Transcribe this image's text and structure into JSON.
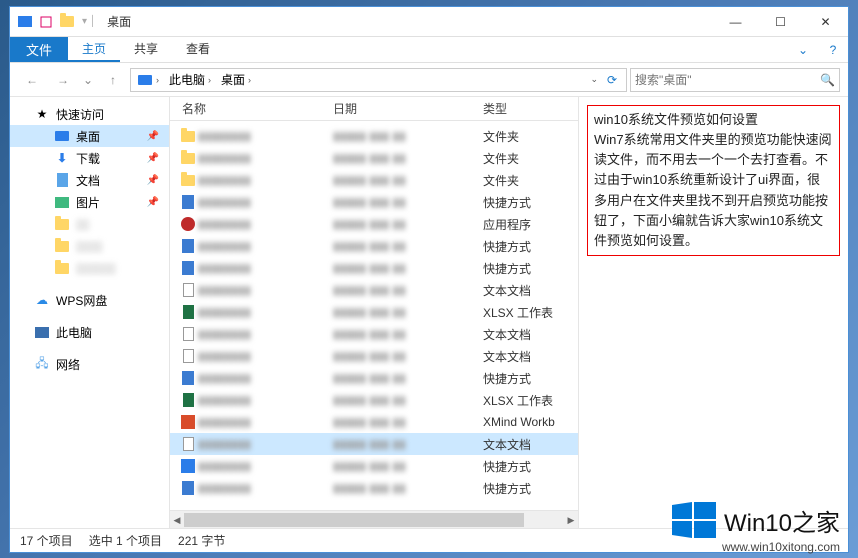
{
  "titlebar": {
    "title": "桌面"
  },
  "ribbon": {
    "file": "文件",
    "tabs": [
      "主页",
      "共享",
      "查看"
    ]
  },
  "address": {
    "segments": [
      "此电脑",
      "桌面"
    ]
  },
  "search": {
    "placeholder": "搜索\"桌面\""
  },
  "sidebar": {
    "quick": "快速访问",
    "items": [
      {
        "label": "桌面",
        "icon": "desktop",
        "pinned": true,
        "selected": true
      },
      {
        "label": "下载",
        "icon": "down",
        "pinned": true
      },
      {
        "label": "文档",
        "icon": "doc",
        "pinned": true
      },
      {
        "label": "图片",
        "icon": "pic",
        "pinned": true
      }
    ],
    "recent": [
      {
        "label": "▯▯",
        "icon": "folder"
      },
      {
        "label": "▯▯▯▯",
        "icon": "folder"
      },
      {
        "label": "▯▯▯▯▯▯",
        "icon": "folder"
      }
    ],
    "wps": "WPS网盘",
    "pc": "此电脑",
    "net": "网络"
  },
  "columns": {
    "name": "名称",
    "date": "日期",
    "type": "类型"
  },
  "rows": [
    {
      "icon": "folder",
      "type": "文件夹"
    },
    {
      "icon": "folder",
      "type": "文件夹"
    },
    {
      "icon": "folder",
      "type": "文件夹"
    },
    {
      "icon": "lnk",
      "type": "快捷方式"
    },
    {
      "icon": "app",
      "type": "应用程序"
    },
    {
      "icon": "lnk",
      "type": "快捷方式"
    },
    {
      "icon": "lnk",
      "type": "快捷方式"
    },
    {
      "icon": "txt",
      "type": "文本文档"
    },
    {
      "icon": "xls",
      "type": "XLSX 工作表"
    },
    {
      "icon": "txt",
      "type": "文本文档"
    },
    {
      "icon": "txt",
      "type": "文本文档"
    },
    {
      "icon": "lnk",
      "type": "快捷方式"
    },
    {
      "icon": "xls",
      "type": "XLSX 工作表"
    },
    {
      "icon": "xm",
      "type": "XMind Workb"
    },
    {
      "icon": "txt",
      "type": "文本文档",
      "selected": true
    },
    {
      "icon": "blue",
      "type": "快捷方式"
    },
    {
      "icon": "lnk",
      "type": "快捷方式"
    }
  ],
  "preview_text": "win10系统文件预览如何设置\nWin7系统常用文件夹里的预览功能快速阅读文件，而不用去一个一个去打查看。不过由于win10系统重新设计了ui界面，很多用户在文件夹里找不到开启预览功能按钮了，下面小编就告诉大家win10系统文件预览如何设置。",
  "status": {
    "total": "17 个项目",
    "selected": "选中 1 个项目",
    "size": "221 字节"
  },
  "brand": {
    "name": "Win10之家",
    "url": "www.win10xitong.com"
  }
}
